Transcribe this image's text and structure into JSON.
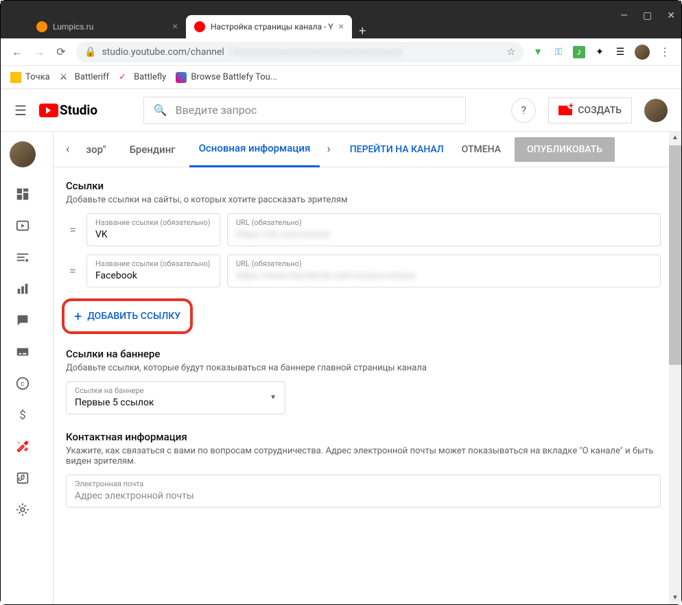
{
  "browser": {
    "tabs": [
      {
        "title": "Lumpics.ru",
        "active": false
      },
      {
        "title": "Настройка страницы канала - Y",
        "active": true
      }
    ],
    "url_visible": "studio.youtube.com/channel",
    "bookmarks": [
      "Точка",
      "Battleriff",
      "Battlefly",
      "Browse Battlefy Tou..."
    ]
  },
  "header": {
    "logo_text": "Studio",
    "search_placeholder": "Введите запрос",
    "create_label": "СОЗДАТЬ"
  },
  "tabs": {
    "prev_label": "зор\"",
    "branding": "Брендинг",
    "basic": "Основная информация",
    "goto_channel": "ПЕРЕЙТИ НА КАНАЛ",
    "cancel": "ОТМЕНА",
    "publish": "ОПУБЛИКОВАТЬ"
  },
  "links": {
    "title": "Ссылки",
    "desc": "Добавьте ссылки на сайты, о которых хотите рассказать зрителям",
    "name_label": "Название ссылки (обязательно)",
    "url_label": "URL (обязательно)",
    "rows": [
      {
        "name": "VK"
      },
      {
        "name": "Facebook"
      }
    ],
    "add_label": "ДОБАВИТЬ ССЫЛКУ"
  },
  "banner": {
    "title": "Ссылки на баннере",
    "desc": "Добавьте ссылки, которые будут показываться на баннере главной страницы канала",
    "select_label": "Ссылки на баннере",
    "select_value": "Первые 5 ссылок"
  },
  "contact": {
    "title": "Контактная информация",
    "desc": "Укажите, как связаться с вами по вопросам сотрудничества. Адрес электронной почты может показываться на вкладке \"О канале\" и быть виден зрителям.",
    "email_label": "Электронная почта",
    "email_placeholder": "Адрес электронной почты"
  }
}
